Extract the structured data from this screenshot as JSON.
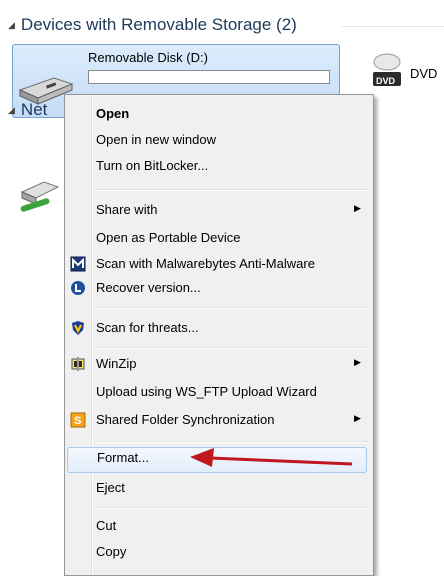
{
  "explorer": {
    "group_header": "Devices with Removable Storage (2)",
    "drive_name": "Removable Disk (D:)",
    "dvd_badge": "DVD",
    "dvd_label": "DVD",
    "network_header_partial": "Net"
  },
  "context_menu": {
    "items": [
      {
        "label": "Open",
        "bold": true
      },
      {
        "label": "Open in new window"
      },
      {
        "label": "Turn on BitLocker..."
      },
      {
        "label": "Share with",
        "submenu": true
      },
      {
        "label": "Open as Portable Device"
      },
      {
        "label": "Scan with Malwarebytes Anti-Malware",
        "icon": "malwarebytes-icon"
      },
      {
        "label": "Recover version...",
        "icon": "recover-icon"
      },
      {
        "label": "Scan for threats...",
        "icon": "shield-icon"
      },
      {
        "label": "WinZip",
        "icon": "winzip-icon",
        "submenu": true
      },
      {
        "label": "Upload using WS_FTP Upload Wizard"
      },
      {
        "label": "Shared Folder Synchronization",
        "icon": "sync-icon",
        "submenu": true
      },
      {
        "label": "Format...",
        "highlighted": true
      },
      {
        "label": "Eject"
      },
      {
        "label": "Cut"
      },
      {
        "label": "Copy"
      }
    ]
  },
  "colors": {
    "annotation_arrow": "#c0181f",
    "group_header": "#1e395b"
  }
}
